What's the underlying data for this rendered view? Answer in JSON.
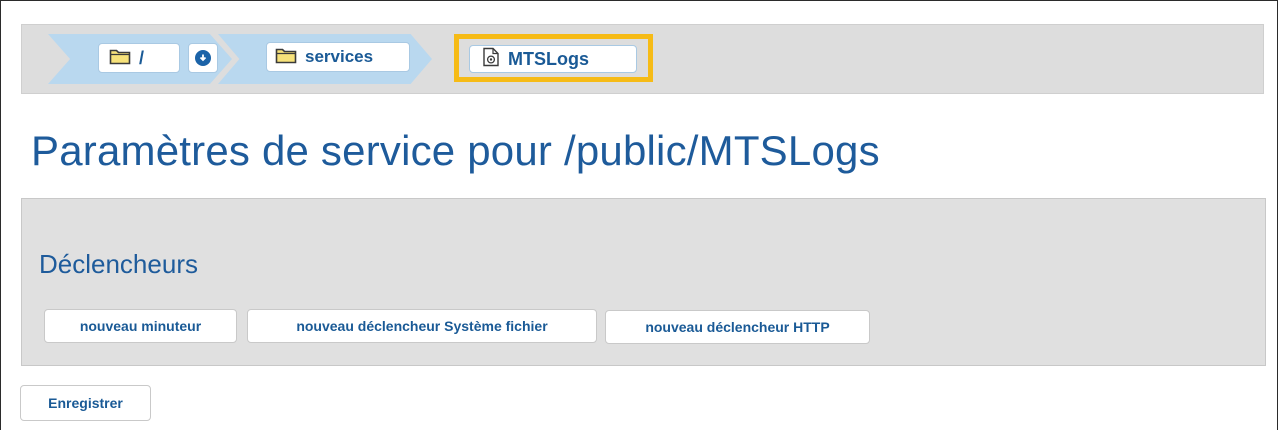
{
  "breadcrumb": {
    "root_label": "/",
    "services_label": "services",
    "current_label": "MTSLogs"
  },
  "page": {
    "title": "Paramètres de service pour /public/MTSLogs"
  },
  "triggers": {
    "heading": "Déclencheurs",
    "new_timer_label": "nouveau minuteur",
    "new_filesystem_trigger_label": "nouveau déclencheur Système fichier",
    "new_http_trigger_label": "nouveau déclencheur HTTP"
  },
  "actions": {
    "save_label": "Enregistrer"
  },
  "colors": {
    "accent_blue": "#1e5b9b",
    "breadcrumb_arrow": "#b9d8ef",
    "highlight": "#f6bb16",
    "panel_bg": "#e0e0e0"
  },
  "icons": [
    "folder-icon",
    "download-icon",
    "service-file-icon"
  ]
}
